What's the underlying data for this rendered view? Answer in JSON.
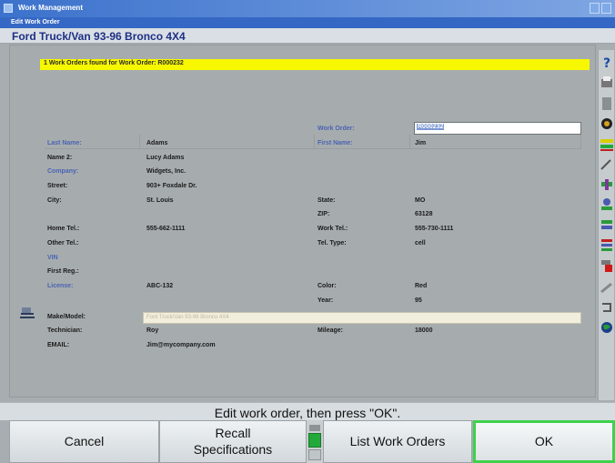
{
  "window": {
    "title": "Work Management"
  },
  "subtitle": "Edit Work Order",
  "vehicle": "Ford Truck/Van 93-96 Bronco 4X4",
  "notice": "1 Work Orders found for Work Order: R000232",
  "form": {
    "work_order": {
      "label": "Work Order:",
      "value": "R000232"
    },
    "last_name": {
      "label": "Last Name:",
      "value": "Adams"
    },
    "first_name": {
      "label": "First Name:",
      "value": "Jim"
    },
    "name2": {
      "label": "Name 2:",
      "value": "Lucy Adams"
    },
    "company": {
      "label": "Company:",
      "value": "Widgets, Inc."
    },
    "street": {
      "label": "Street:",
      "value": "903+ Foxdale Dr."
    },
    "city": {
      "label": "City:",
      "value": "St. Louis"
    },
    "state": {
      "label": "State:",
      "value": "MO"
    },
    "zip": {
      "label": "ZIP:",
      "value": "63128"
    },
    "home_tel": {
      "label": "Home Tel.:",
      "value": "555-662-1111"
    },
    "work_tel": {
      "label": "Work Tel.:",
      "value": "555-730-1111"
    },
    "other_tel": {
      "label": "Other Tel.:",
      "value": ""
    },
    "tel_type": {
      "label": "Tel. Type:",
      "value": "cell"
    },
    "vin": {
      "label": "VIN",
      "value": ""
    },
    "first_reg": {
      "label": "First Reg.:",
      "value": ""
    },
    "license": {
      "label": "License:",
      "value": "ABC-132"
    },
    "color": {
      "label": "Color:",
      "value": "Red"
    },
    "year": {
      "label": "Year:",
      "value": "95"
    },
    "make_model": {
      "label": "Make/Model:",
      "value": "Ford Truck/Van 93-96 Bronco 4X4"
    },
    "technician": {
      "label": "Technician:",
      "value": "Roy"
    },
    "mileage": {
      "label": "Mileage:",
      "value": "18000"
    },
    "email": {
      "label": "EMAIL:",
      "value": "Jim@mycompany.com"
    }
  },
  "status_message": "Edit work order, then press \"OK\".",
  "buttons": {
    "cancel": "Cancel",
    "recall_line1": "Recall",
    "recall_line2": "Specifications",
    "list": "List Work Orders",
    "ok": "OK"
  },
  "colors": {
    "title_blue": "#3c72cc",
    "notice_yellow": "#f7f700",
    "ok_border": "#3ed14b",
    "label_blue": "#4b63b2"
  },
  "sidebar_icons": [
    "help-icon",
    "printer-icon",
    "wrench-icon",
    "gauge-icon",
    "alignment-bar-icon",
    "tool-icon",
    "camber-icon",
    "sensor-icon",
    "vehicle-spec-icon",
    "level-icon",
    "red-tool-icon",
    "wrench2-icon",
    "arrow-icon",
    "globe-icon"
  ]
}
